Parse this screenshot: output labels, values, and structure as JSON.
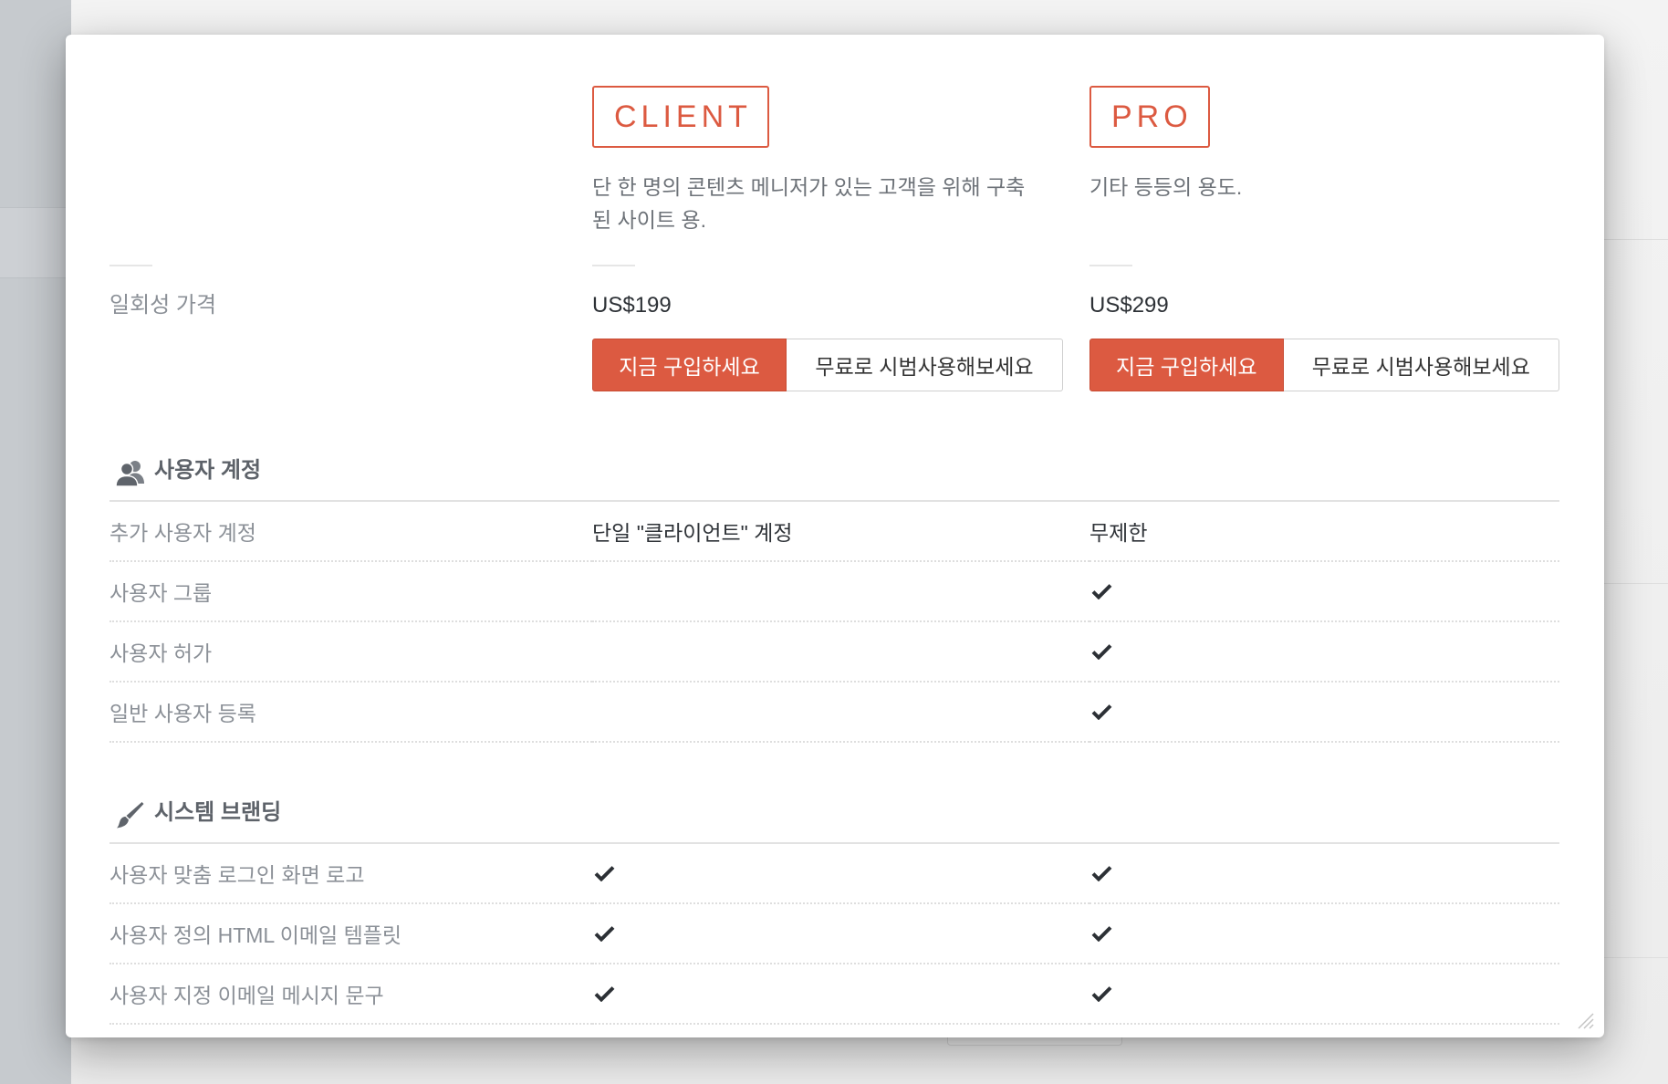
{
  "colors": {
    "accent": "#dc5a41"
  },
  "plans": [
    {
      "name": "CLIENT",
      "description": "단 한 명의 콘텐츠 메니저가 있는 고객을 위해 구축된 사이트 용.",
      "price": "US$199",
      "buy_label": "지금 구입하세요",
      "trial_label": "무료로 시범사용해보세요"
    },
    {
      "name": "PRO",
      "description": "기타 등등의 용도.",
      "price": "US$299",
      "buy_label": "지금 구입하세요",
      "trial_label": "무료로 시범사용해보세요"
    }
  ],
  "pricing_label": "일회성 가격",
  "sections": [
    {
      "title": "사용자 계정",
      "icon": "users-icon",
      "rows": [
        {
          "label": "추가 사용자 계정",
          "values": [
            "단일 \"클라이언트\" 계정",
            "무제한"
          ]
        },
        {
          "label": "사용자 그룹",
          "values": [
            false,
            true
          ]
        },
        {
          "label": "사용자 허가",
          "values": [
            false,
            true
          ]
        },
        {
          "label": "일반 사용자 등록",
          "values": [
            false,
            true
          ]
        }
      ]
    },
    {
      "title": "시스템 브랜딩",
      "icon": "brush-icon",
      "rows": [
        {
          "label": "사용자 맞춤 로그인 화면 로고",
          "values": [
            true,
            true
          ]
        },
        {
          "label": "사용자 정의 HTML 이메일 템플릿",
          "values": [
            true,
            true
          ]
        },
        {
          "label": "사용자 지정 이메일 메시지 문구",
          "values": [
            true,
            true
          ]
        }
      ]
    }
  ]
}
